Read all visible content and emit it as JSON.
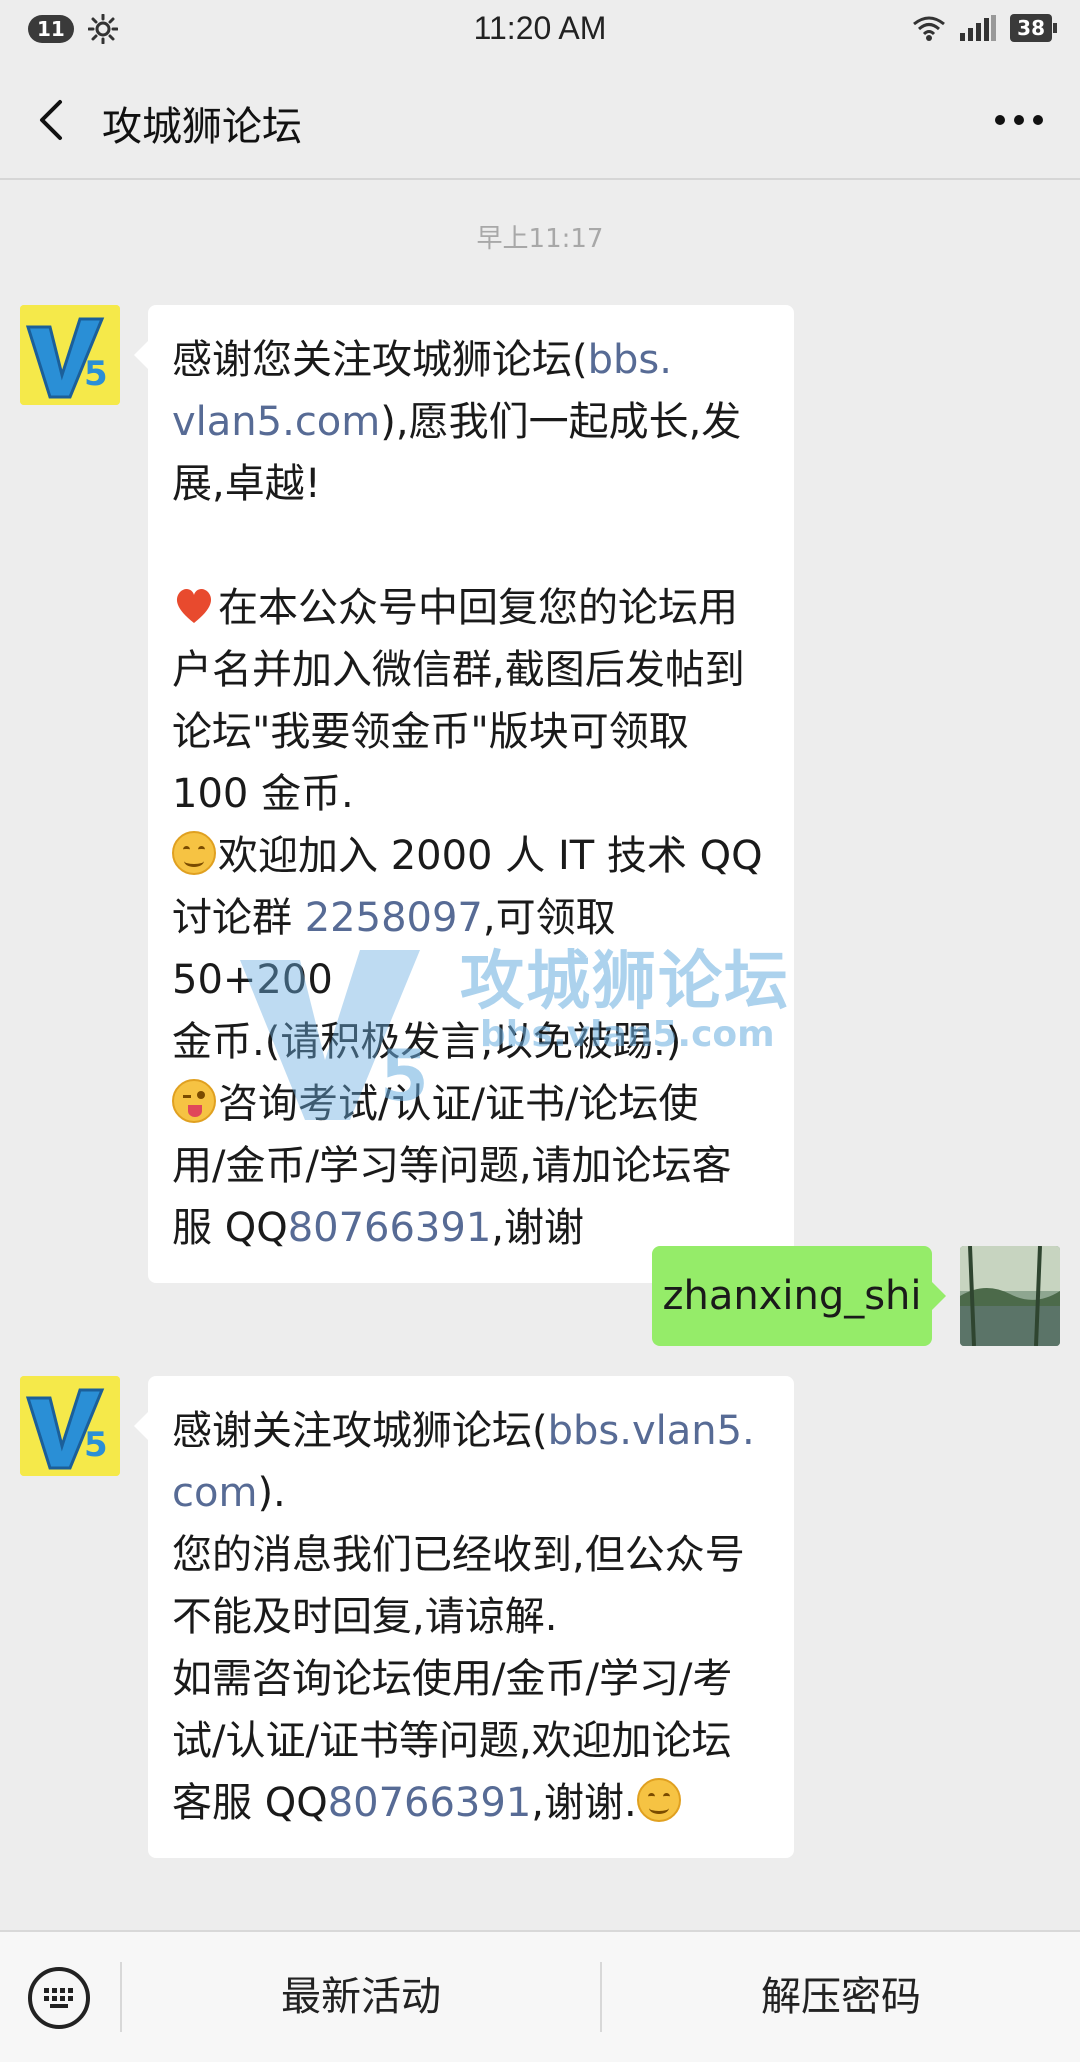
{
  "status_bar": {
    "notification_count": "11",
    "time": "11:20 AM",
    "battery": "38"
  },
  "nav": {
    "title": "攻城狮论坛"
  },
  "chat": {
    "timestamp": "早上11:17",
    "messages": [
      {
        "sender": "bot",
        "segments": {
          "p1": "感谢您关注攻城狮论坛(",
          "p1_link": "bbs.\nvlan5.com",
          "p1_end": "),愿我们一起成长,发\n展,卓越!\n\n",
          "p2": "在本公众号中回复您的论坛用\n户名并加入微信群,截图后发帖到\n论坛\"我要领金币\"版块可领取\n100 金币.\n",
          "p3": "欢迎加入 2000 人 IT 技术 QQ\n讨论群 ",
          "p3_link": "2258097",
          "p3_end": ",可领取 50+200\n金币.(请积极发言,以免被踢.)\n",
          "p4": "咨询考试/认证/证书/论坛使\n用/金币/学习等问题,请加论坛客\n服 QQ",
          "p4_link": "80766391",
          "p4_end": ",谢谢"
        }
      },
      {
        "sender": "user",
        "text": "zhanxing_shi"
      },
      {
        "sender": "bot",
        "segments": {
          "p1": "感谢关注攻城狮论坛(",
          "p1_link": "bbs.vlan5.\ncom",
          "p1_end": ").\n您的消息我们已经收到,但公众号\n不能及时回复,请谅解.\n如需咨询论坛使用/金币/学习/考\n试/认证/证书等问题,欢迎加论坛\n客服 QQ",
          "p2_link": "80766391",
          "p2_end": ",谢谢."
        }
      }
    ]
  },
  "watermark": {
    "text": "攻城狮论坛",
    "sub": "bbs.vlan5.com"
  },
  "bottom_menu": {
    "item1": "最新活动",
    "item2": "解压密码"
  },
  "colors": {
    "background": "#ededed",
    "bubble_bot": "#ffffff",
    "bubble_user": "#95ec69",
    "link": "#576b95"
  }
}
